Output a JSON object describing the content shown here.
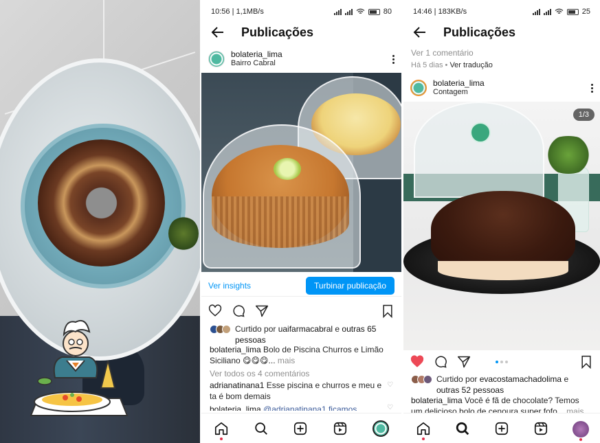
{
  "panel1": {
    "badge_label": "food-illustration"
  },
  "panel2": {
    "status": {
      "time": "10:56",
      "speed": "1,1MB/s",
      "battery": "80"
    },
    "header": {
      "title": "Publicações"
    },
    "post": {
      "username": "bolateria_lima",
      "location": "Bairro Cabral"
    },
    "insights_link": "Ver insights",
    "boost_button": "Turbinar publicação",
    "likes": {
      "prefix": "Curtido por ",
      "user": "uaifarmacabral",
      "middle": " e ",
      "others": "outras 65 pessoas"
    },
    "caption": {
      "username": "bolateria_lima",
      "text": " Bolo de Piscina Churros e Limão Siciliano 😋😋😋...",
      "more": " mais"
    },
    "view_comments": "Ver todos os 4 comentários",
    "comments": [
      {
        "username": "adrianatinana1",
        "text": " Esse piscina e churros e meu e ta é bom demais"
      },
      {
        "username": "bolateria_lima",
        "text": " @adrianatinana1 ficamos"
      }
    ]
  },
  "panel3": {
    "status": {
      "time": "14:46",
      "speed": "183KB/s",
      "battery": "25"
    },
    "header": {
      "title": "Publicações"
    },
    "prev": {
      "view_comment": "Ver 1 comentário",
      "time": "Há 5 dias",
      "sep": " • ",
      "translate": "Ver tradução"
    },
    "post": {
      "username": "bolateria_lima",
      "location": "Contagem",
      "counter": "1/3"
    },
    "likes": {
      "prefix": "Curtido por ",
      "user": "evacostamachadolima",
      "middle": " e ",
      "others": "outras 52 pessoas"
    },
    "caption": {
      "username": "bolateria_lima",
      "text": " Você é fã de chocolate? Temos um delicioso bolo de cenoura super fofo...",
      "more": " mais"
    }
  },
  "colors": {
    "accent": "#0095f6",
    "like": "#ed4956",
    "notif": "#e2304b"
  }
}
